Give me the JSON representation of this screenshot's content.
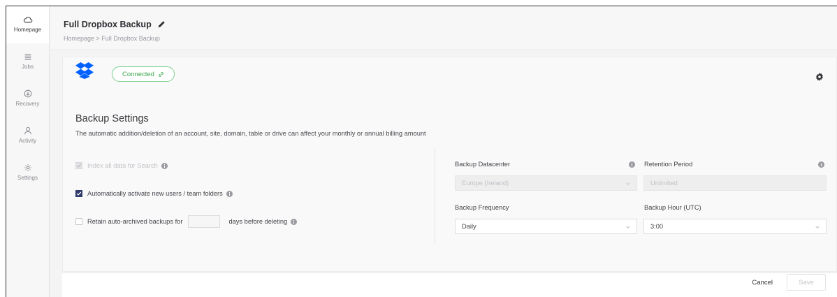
{
  "sidebar": {
    "items": [
      {
        "label": "Homepage",
        "icon": "cloud-icon"
      },
      {
        "label": "Jobs",
        "icon": "list-icon"
      },
      {
        "label": "Recovery",
        "icon": "recovery-icon"
      },
      {
        "label": "Activity",
        "icon": "person-icon"
      },
      {
        "label": "Settings",
        "icon": "gear-icon"
      }
    ]
  },
  "header": {
    "title": "Full Dropbox Backup",
    "breadcrumb": "Homepage > Full Dropbox Backup"
  },
  "card": {
    "status": "Connected",
    "section_title": "Backup Settings",
    "description": "The automatic addition/deletion of an account, site, domain, table or drive can affect your monthly or annual billing amount",
    "options": {
      "index_search": "Index all data for Search",
      "auto_activate": "Automatically activate new users / team folders",
      "retain_prefix": "Retain auto-archived backups for",
      "retain_suffix": "days before deleting"
    },
    "fields": {
      "datacenter_label": "Backup Datacenter",
      "datacenter_value": "Europe (Ireland)",
      "retention_label": "Retention Period",
      "retention_value": "Unlimited",
      "frequency_label": "Backup Frequency",
      "frequency_value": "Daily",
      "hour_label": "Backup Hour (UTC)",
      "hour_value": "3:00"
    }
  },
  "footer": {
    "cancel_label": "Cancel",
    "save_label": "Save"
  },
  "colors": {
    "accent": "#2f3a6b",
    "connected_green": "#3aa64c",
    "dropbox_blue": "#0061ff"
  }
}
